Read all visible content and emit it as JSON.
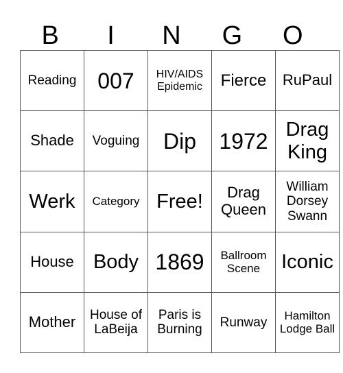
{
  "header": [
    "B",
    "I",
    "N",
    "G",
    "O"
  ],
  "rows": [
    [
      "Reading",
      "007",
      "HIV/AIDS Epidemic",
      "Fierce",
      "RuPaul"
    ],
    [
      "Shade",
      "Voguing",
      "Dip",
      "1972",
      "Drag King"
    ],
    [
      "Werk",
      "Category",
      "Free!",
      "Drag Queen",
      "William Dorsey Swann"
    ],
    [
      "House",
      "Body",
      "1869",
      "Ballroom Scene",
      "Iconic"
    ],
    [
      "Mother",
      "House of LaBeija",
      "Paris is Burning",
      "Runway",
      "Hamilton Lodge Ball"
    ]
  ]
}
